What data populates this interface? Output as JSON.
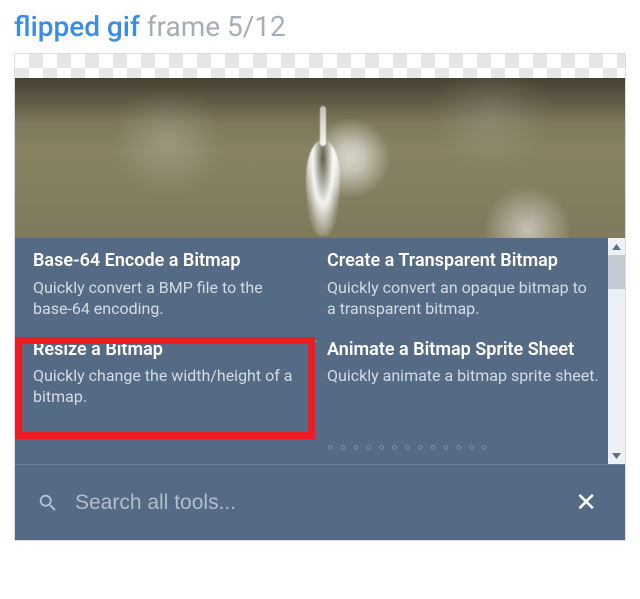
{
  "header": {
    "name": "flipped gif",
    "frame_label": "frame",
    "frame_index": 5,
    "frame_total": 12
  },
  "tools": {
    "left": [
      {
        "title": "Base-64 Encode a Bitmap",
        "desc": "Quickly convert a BMP file to the base-64 encoding."
      },
      {
        "title": "Resize a Bitmap",
        "desc": "Quickly change the width/height of a bitmap."
      }
    ],
    "right": [
      {
        "title": "Create a Transparent Bitmap",
        "desc": "Quickly convert an opaque bitmap to a transparent bitmap."
      },
      {
        "title": "Animate a Bitmap Sprite Sheet",
        "desc": "Quickly animate a bitmap sprite sheet."
      }
    ]
  },
  "search": {
    "placeholder": "Search all tools...",
    "value": "",
    "clear_glyph": "✕"
  },
  "frame_text": "frame 5/12"
}
